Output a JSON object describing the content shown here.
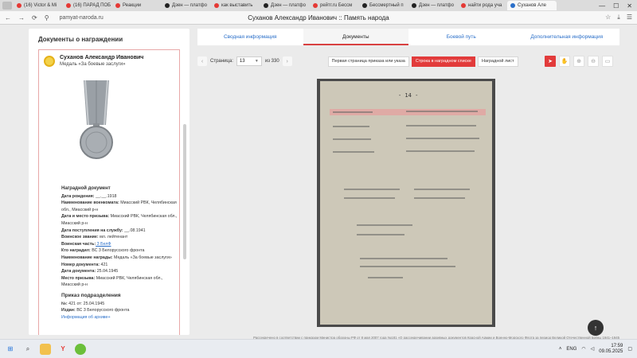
{
  "browser": {
    "tabs": [
      {
        "label": "(16) Victor & Mi",
        "color": "#e53935"
      },
      {
        "label": "(16) ПАРАД ПОБ",
        "color": "#e53935"
      },
      {
        "label": "Реакции",
        "color": "#e53935"
      },
      {
        "label": "Дзен — платфо",
        "color": "#222222"
      },
      {
        "label": "как выставить",
        "color": "#e53935"
      },
      {
        "label": "Дзен — платфо",
        "color": "#222222"
      },
      {
        "label": "рейтг.ru Бессм",
        "color": "#e53935"
      },
      {
        "label": "Бессмертный п",
        "color": "#222222"
      },
      {
        "label": "Дзен — платфо",
        "color": "#222222"
      },
      {
        "label": "найти рода уча",
        "color": "#e53935"
      },
      {
        "label": "Суханов Але",
        "color": "#2a6fc9"
      }
    ],
    "url": "pamyat-naroda.ru",
    "page_title": "Суханов Александр Иванович :: Память народа"
  },
  "left": {
    "section_title": "Документы о награждении",
    "person_name": "Суханов Александр Иванович",
    "medal_name": "Медаль «За боевые заслуги»",
    "award_doc_header": "Наградной документ",
    "rows": [
      {
        "k": "Дата рождения:",
        "v": " __.__.1918"
      },
      {
        "k": "Наименование военкомата:",
        "v": " Миасский РВК, Челябинская обл., Миасский р-н"
      },
      {
        "k": "Дата и место призыва:",
        "v": " Миасский РВК, Челябинская обл., Миасский р-н"
      },
      {
        "k": "Дата поступления на службу:",
        "v": " __.08.1941"
      },
      {
        "k": "Воинское звание:",
        "v": " мл. лейтенант"
      },
      {
        "k": "Воинская часть:",
        "v": " 3 БелФ",
        "link": true
      },
      {
        "k": "Кто наградил:",
        "v": " ВС 3 Белорусского фронта"
      },
      {
        "k": "Наименование награды:",
        "v": " Медаль «За боевые заслуги»"
      },
      {
        "k": "Номер документа:",
        "v": " 421"
      },
      {
        "k": "Дата документа:",
        "v": " 25.04.1945"
      },
      {
        "k": "Место призыва:",
        "v": " Миасский РВК, Челябинская обл., Миасский р-н"
      }
    ],
    "order_header": "Приказ подразделения",
    "order_rows": [
      {
        "k": "№:",
        "v": " 421 от: 25.04.1945"
      },
      {
        "k": "Издан:",
        "v": " ВС 3 Белорусского фронта"
      }
    ],
    "archive_link": "Информация об архиве+"
  },
  "right": {
    "tabs": [
      {
        "label": "Сводная информация",
        "active": false
      },
      {
        "label": "Документы",
        "active": true
      },
      {
        "label": "Боевой путь",
        "active": false
      },
      {
        "label": "Дополнительная информация",
        "active": false
      }
    ],
    "page_label": "Страница:",
    "page_value": "13",
    "page_of": "из 330",
    "doc_buttons": [
      {
        "label": "Первая страница приказа или указа",
        "active": false
      },
      {
        "label": "Строка в наградном списке",
        "active": true
      },
      {
        "label": "Наградной лист",
        "active": false
      }
    ],
    "scan_page_number": "- 14 -",
    "footer_note": "Рассекречено в соответствии с приказом Министра обороны РФ от 8 мая 2007 года №181 «О рассекречивании архивных документов Красной Армии и Военно-Морского Флота за период Великой Отечественной войны 1941–1945"
  },
  "taskbar": {
    "lang": "ENG",
    "time": "17:59",
    "date": "09.05.2025"
  },
  "accent_color": "#e23b3b",
  "link_color": "#2a6fc9"
}
